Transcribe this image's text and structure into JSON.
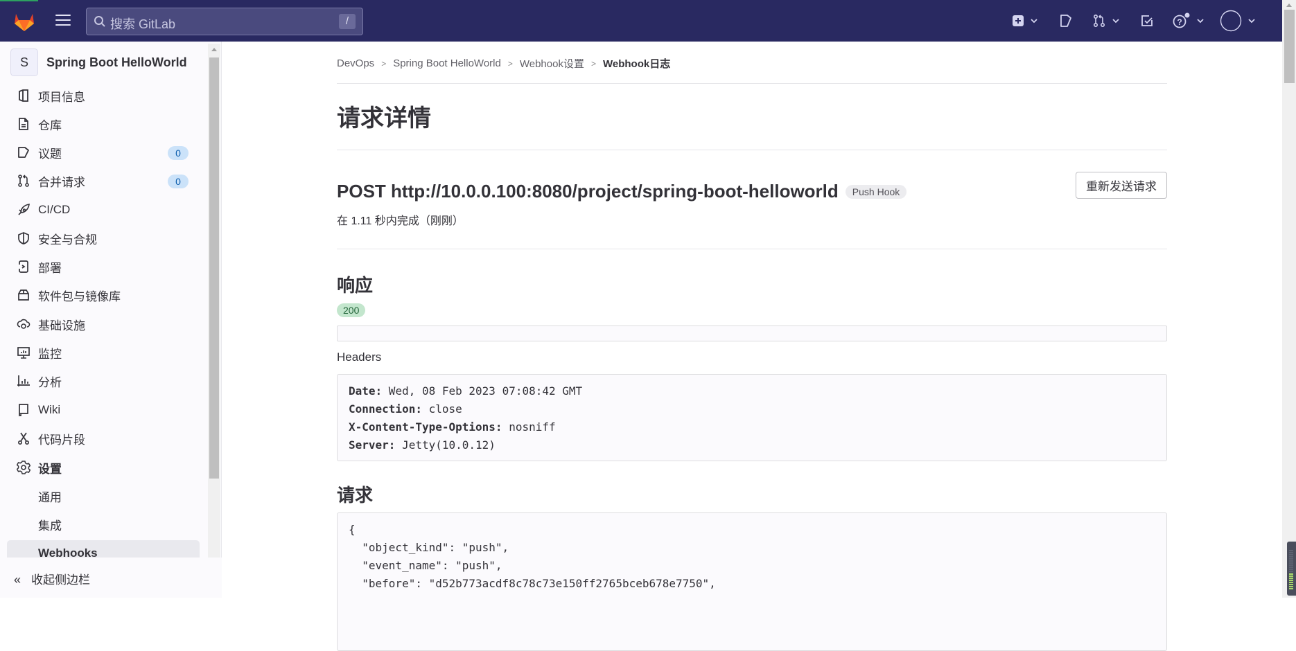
{
  "header": {
    "search_placeholder": "搜索 GitLab",
    "search_shortcut": "/",
    "icons": [
      "create-new-icon",
      "issues-icon",
      "merge-requests-icon",
      "todos-icon",
      "help-icon",
      "user-avatar"
    ]
  },
  "sidebar": {
    "project_initial": "S",
    "project_name": "Spring Boot HelloWorld",
    "items": [
      {
        "label": "项目信息",
        "icon": "project-info-icon"
      },
      {
        "label": "仓库",
        "icon": "repository-icon"
      },
      {
        "label": "议题",
        "icon": "issues-icon",
        "badge": "0"
      },
      {
        "label": "合并请求",
        "icon": "merge-request-icon",
        "badge": "0"
      },
      {
        "label": "CI/CD",
        "icon": "rocket-icon"
      },
      {
        "label": "安全与合规",
        "icon": "shield-icon"
      },
      {
        "label": "部署",
        "icon": "deploy-icon"
      },
      {
        "label": "软件包与镜像库",
        "icon": "package-icon"
      },
      {
        "label": "基础设施",
        "icon": "cloud-gear-icon"
      },
      {
        "label": "监控",
        "icon": "monitor-icon"
      },
      {
        "label": "分析",
        "icon": "chart-icon"
      },
      {
        "label": "Wiki",
        "icon": "book-icon"
      },
      {
        "label": "代码片段",
        "icon": "snippet-icon"
      },
      {
        "label": "设置",
        "icon": "gear-icon"
      }
    ],
    "sub_items": [
      {
        "label": "通用"
      },
      {
        "label": "集成"
      },
      {
        "label": "Webhooks",
        "active": true
      }
    ],
    "collapse_label": "收起侧边栏"
  },
  "breadcrumb": [
    "DevOps",
    "Spring Boot HelloWorld",
    "Webhook设置",
    "Webhook日志"
  ],
  "page": {
    "title": "请求详情",
    "request_line": "POST http://10.0.0.100:8080/project/spring-boot-helloworld",
    "hook_type": "Push Hook",
    "resend_label": "重新发送请求",
    "duration": "在 1.11 秒内完成（刚刚）",
    "response_heading": "响应",
    "status_code": "200",
    "response_body": "",
    "headers_label": "Headers",
    "headers": [
      {
        "key": "Date:",
        "value": " Wed, 08 Feb 2023 07:08:42 GMT"
      },
      {
        "key": "Connection:",
        "value": " close"
      },
      {
        "key": "X-Content-Type-Options:",
        "value": " nosniff"
      },
      {
        "key": "Server:",
        "value": " Jetty(10.0.12)"
      }
    ],
    "request_heading": "请求",
    "request_body_lines": [
      "{",
      "  \"object_kind\": \"push\",",
      "  \"event_name\": \"push\",",
      "  \"before\": \"d52b773acdf8c78c73e150ff2765bceb678e7750\","
    ]
  },
  "colors": {
    "topbar": "#292961",
    "status_success_bg": "#c3e6cd",
    "badge_bg": "#cbe2f9"
  }
}
